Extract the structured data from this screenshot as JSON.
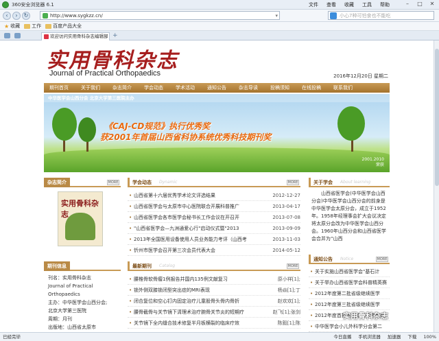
{
  "browser": {
    "title": "360安全浏览器 6.1",
    "menus": [
      "文件",
      "查看",
      "收藏",
      "工具",
      "帮助"
    ],
    "address": "http://www.sygkzz.cn/",
    "search_placeholder": "小心7种可怕食也不能吃",
    "favorites": [
      "收藏",
      "工作",
      "百度产品大全"
    ],
    "tab_title": "欢迎访问实用骨科杂志编辑部"
  },
  "site": {
    "logo_cn": "实用骨科杂志",
    "logo_en": "Journal of Practical Orthopaedics",
    "date": "2016年12月20日 星期二",
    "nav": [
      "期刊首页",
      "关于我们",
      "杂志简介",
      "学会动态",
      "学术活动",
      "通知公告",
      "杂志导读",
      "投稿须知",
      "在线投稿",
      "联系我们"
    ]
  },
  "banner": {
    "strip": "中华医学会山西分会 北京大学第三医院主办",
    "line1": "《CAJ-CD规范》执行优秀奖",
    "line2": "获2001年首届山西省科协系统优秀科技期刊奖",
    "stamp1": "2001.2010",
    "stamp2": "荣获"
  },
  "left": {
    "intro_title": "杂志简介",
    "more": "MORE",
    "cover_title": "实用骨科杂志",
    "info_title": "期刊信息",
    "info": [
      "刊名：实用骨科杂志",
      "Journal of Practical",
      "Orthopaedics",
      "主办：中华医学会山西分会;",
      "北京大学第三医院",
      "周期：月刊",
      "出版地：山西省太原市"
    ]
  },
  "center": {
    "news_title": "学会动态",
    "news_sub": "Dynamic",
    "news": [
      {
        "title": "山西省第十六届优秀学术论文评选结果",
        "date": "2012-12-27"
      },
      {
        "title": "山西省医学会与太原市中心医院联合开展科普推广",
        "date": "2013-04-17"
      },
      {
        "title": "山西省医学会各市医学会秘书长工作会议在开召开",
        "date": "2013-07-08"
      },
      {
        "title": "\"山西省医学会—九洲通爱心行\"启动仪式暨\"2013",
        "date": "2013-09-09"
      },
      {
        "title": "2013年全国医用设备使用人员业务能力考评（山西考",
        "date": "2013-11-03"
      },
      {
        "title": "忻州市医学会召开第三次会员代表大会",
        "date": "2014-05-12"
      }
    ],
    "latest_title": "最新期刊",
    "latest_sub": "Catalog",
    "latest": [
      {
        "title": "腰椎骨软骨瘤1例报告并国内135例文献复习",
        "date": "原小祥[1];"
      },
      {
        "title": "锁外侧双膝锁闭型突出症的MRI表现",
        "date": "杨焱[1];丁"
      },
      {
        "title": "闭合复位和空心钉内固定治疗儿童股骨头骨内骨折",
        "date": "赵欢欢[1];"
      },
      {
        "title": "腰骨截骨与关节镜下清理术治疗腕骨关节炎的短期疗",
        "date": "赵飞[1];张剑"
      },
      {
        "title": "关节镜下全内缝合技术修复半月板横裂的临床疗效",
        "date": "陈毅[1];陈"
      }
    ]
  },
  "right": {
    "about_title": "关于学会",
    "about_sub": "About learning",
    "about_text": "山西省医学会(中华医学会山西分会)中华医学会山西分会的前身是中华医学会太原分会，成立于1952年。1958年经理事会扩大会议决定将太原分会改为中华医学会山西分会。1960年山西分会和山西省医学会合并为“山西",
    "notice_title": "通知公告",
    "notice_sub": "Notice",
    "notices": [
      "关于实施山西省医学会\"基石计",
      "关于举办山西省医学会科普精英赛",
      "2012年度第二批省级继续医学",
      "2012年度第三批省级继续医学",
      "2012年度首批省级继续医学教育",
      "中华医学会小儿外科学分会第二"
    ]
  },
  "status": {
    "left": "已经完毕",
    "right": [
      "今日直播",
      "手机浏览器",
      "加速器",
      "下载",
      "100%"
    ]
  },
  "watermark": "实用骨科杂志"
}
